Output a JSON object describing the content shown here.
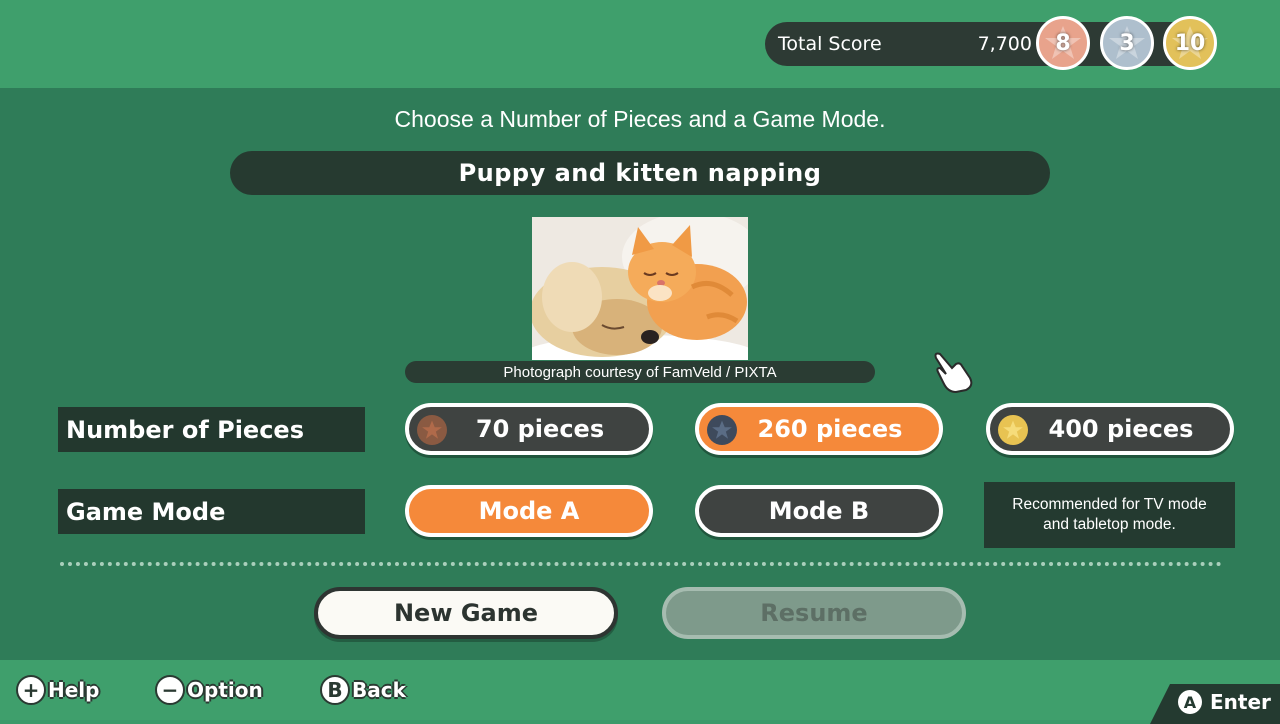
{
  "header": {
    "total_score_label": "Total Score",
    "total_score_value": "7,700",
    "medals": [
      {
        "kind": "bronze-star-medal",
        "count": "8",
        "color": "#e8a38c"
      },
      {
        "kind": "silver-star-medal",
        "count": "3",
        "color": "#aebfcd"
      },
      {
        "kind": "gold-star-medal",
        "count": "10",
        "color": "#e2c15a"
      }
    ]
  },
  "main": {
    "instruction": "Choose a Number of Pieces and a Game Mode.",
    "puzzle_title": "Puppy and kitten napping",
    "photo_icon": "puppy-kitten-photo",
    "photo_credit": "Photograph courtesy of FamVeld / PIXTA",
    "pieces": {
      "label": "Number of Pieces",
      "options": [
        {
          "label": "70 pieces",
          "selected": false,
          "coin": "bronze-coin-icon"
        },
        {
          "label": "260 pieces",
          "selected": true,
          "coin": "silver-coin-icon"
        },
        {
          "label": "400 pieces",
          "selected": false,
          "coin": "gold-coin-icon"
        }
      ]
    },
    "mode": {
      "label": "Game Mode",
      "options": [
        {
          "label": "Mode A",
          "selected": true
        },
        {
          "label": "Mode B",
          "selected": false
        }
      ],
      "hint_line1": "Recommended for TV mode",
      "hint_line2": "and tabletop mode."
    },
    "actions": {
      "new_game": "New Game",
      "resume": "Resume",
      "resume_enabled": false
    }
  },
  "footer": {
    "help": {
      "glyph": "+",
      "label": "Help"
    },
    "option": {
      "glyph": "−",
      "label": "Option"
    },
    "back": {
      "glyph": "B",
      "label": "Back"
    },
    "enter": {
      "glyph": "A",
      "label": "Enter"
    }
  },
  "colors": {
    "selected_accent": "#f5893a",
    "panel_bg": "#2f7c58",
    "band_bg": "#3f9f6c"
  }
}
